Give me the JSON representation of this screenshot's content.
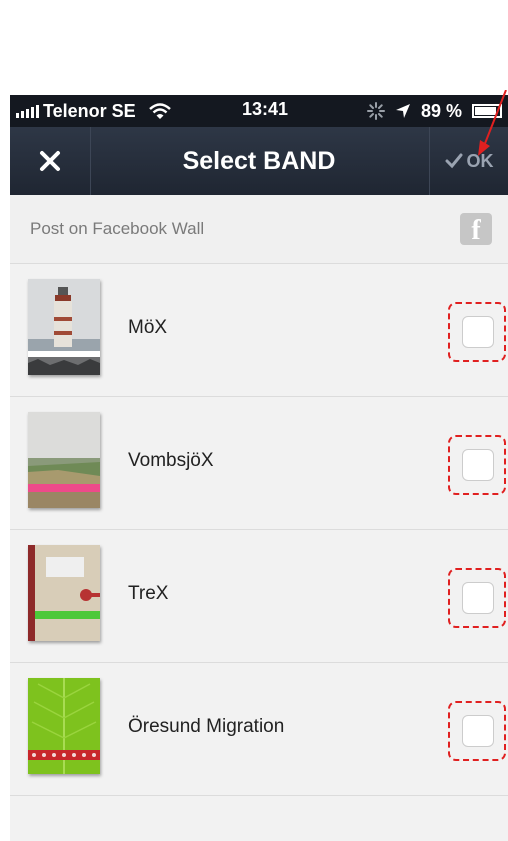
{
  "status_bar": {
    "carrier": "Telenor SE",
    "time": "13:41",
    "battery": "89 %",
    "battery_level": 0.89
  },
  "nav": {
    "title": "Select BAND",
    "ok_label": "OK"
  },
  "facebook_row": {
    "label": "Post on Facebook Wall",
    "icon_letter": "f"
  },
  "bands": [
    {
      "name": "MöX",
      "thumb": "lighthouse",
      "checked": false
    },
    {
      "name": "VombsjöX",
      "thumb": "field",
      "checked": false
    },
    {
      "name": "TreX",
      "thumb": "notebook",
      "checked": false
    },
    {
      "name": "Öresund Migration",
      "thumb": "leaf",
      "checked": false
    }
  ],
  "colors": {
    "navbar": "#2a3240",
    "status_bar": "#141820",
    "highlight": "#e02020",
    "list_bg": "#f2f2f2"
  }
}
